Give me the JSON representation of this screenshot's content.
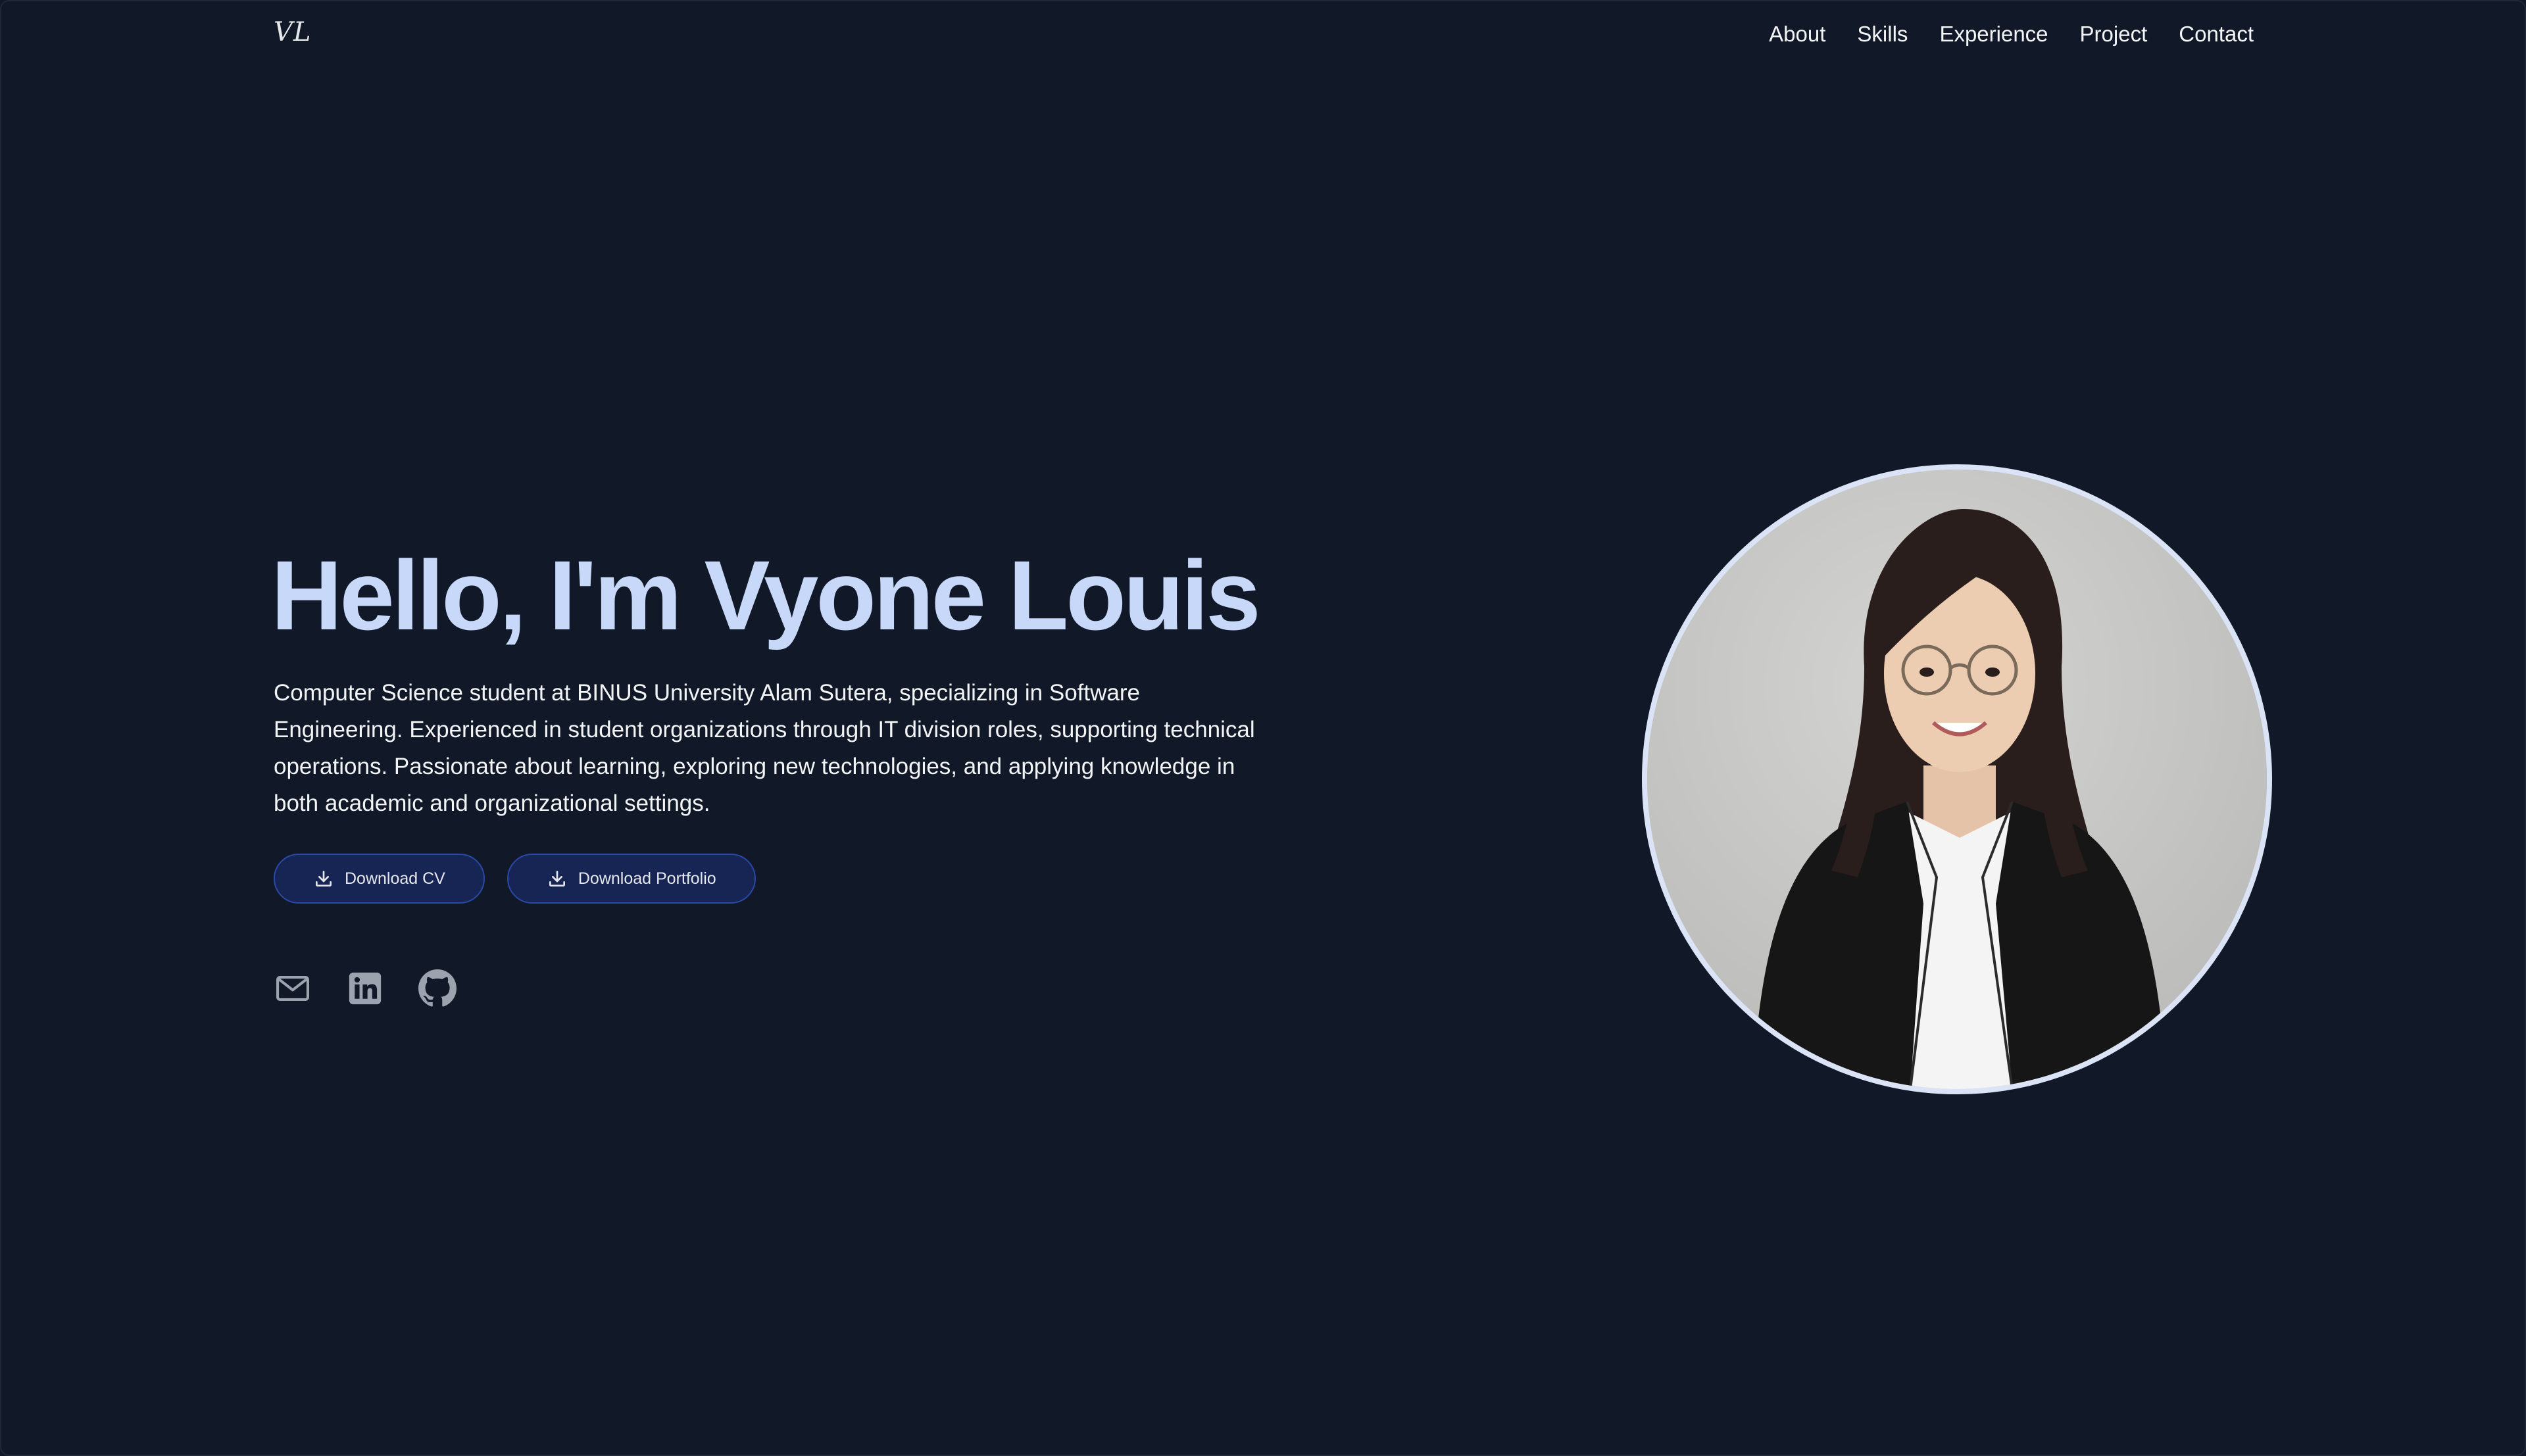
{
  "header": {
    "logo": "VL",
    "nav": [
      "About",
      "Skills",
      "Experience",
      "Project",
      "Contact"
    ]
  },
  "hero": {
    "title": "Hello, I'm Vyone Louis",
    "description": "Computer Science student at BINUS University Alam Sutera, specializing in Software Engineering. Experienced in student organizations through IT division roles, supporting technical operations. Passionate about learning, exploring new technologies, and applying knowledge in both academic and organizational settings.",
    "buttons": {
      "cv_label": "Download CV",
      "portfolio_label": "Download Portfolio"
    },
    "socials": [
      "mail-icon",
      "linkedin-icon",
      "github-icon"
    ]
  },
  "portrait": {
    "alt": "Vyone Louis"
  },
  "colors": {
    "background": "#111827",
    "accent_heading": "#c7d8f8",
    "button_bg": "#172554",
    "button_border": "#2b4aa8",
    "portrait_ring": "#dbe4f7"
  }
}
